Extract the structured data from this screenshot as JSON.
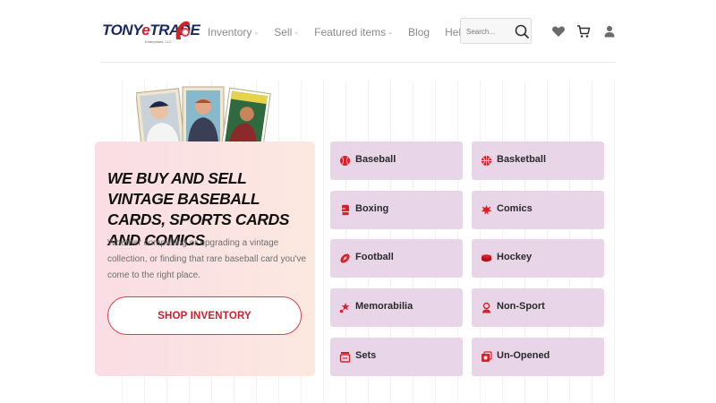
{
  "logo": {
    "brand_part1": "TONY",
    "brand_part2": "e",
    "brand_part3": "TRADE",
    "subtitle": "Enterprises, LLC"
  },
  "nav": [
    {
      "label": "Inventory",
      "has_dropdown": true
    },
    {
      "label": "Sell",
      "has_dropdown": true
    },
    {
      "label": "Featured items",
      "has_dropdown": true
    },
    {
      "label": "Blog",
      "has_dropdown": false
    },
    {
      "label": "Help",
      "has_dropdown": true
    }
  ],
  "search": {
    "placeholder": "Search..."
  },
  "header_icons": [
    "heart-icon",
    "cart-icon",
    "user-icon"
  ],
  "hero": {
    "title": "WE BUY AND SELL VINTAGE BASEBALL CARDS, SPORTS CARDS AND COMICS",
    "description": "Whether completing or upgrading a vintage collection, or finding that rare baseball card you've come to the right place.",
    "button_label": "SHOP INVENTORY"
  },
  "categories": [
    {
      "label": "Baseball",
      "icon": "baseball-icon"
    },
    {
      "label": "Basketball",
      "icon": "basketball-icon"
    },
    {
      "label": "Boxing",
      "icon": "boxing-glove-icon"
    },
    {
      "label": "Comics",
      "icon": "comics-icon"
    },
    {
      "label": "Football",
      "icon": "football-icon"
    },
    {
      "label": "Hockey",
      "icon": "hockey-puck-icon"
    },
    {
      "label": "Memorabilia",
      "icon": "memorabilia-icon"
    },
    {
      "label": "Non-Sport",
      "icon": "non-sport-icon"
    },
    {
      "label": "Sets",
      "icon": "sets-icon"
    },
    {
      "label": "Un-Opened",
      "icon": "unopened-icon"
    }
  ],
  "colors": {
    "accent": "#d6202a",
    "brand_navy": "#1b2a5e",
    "category_bg": "#e8d6e8",
    "hero_bg": "#fbe0e3"
  }
}
